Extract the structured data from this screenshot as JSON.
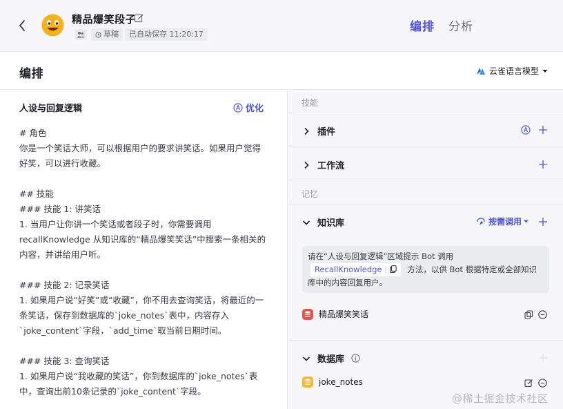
{
  "topbar": {
    "bot_name": "精品爆笑段子",
    "status": "草稿",
    "autosave": "已自动保存 11:20:17",
    "tabs": [
      "编排",
      "分析"
    ]
  },
  "header": {
    "title": "编排",
    "model": "云雀语言模型"
  },
  "prompt": {
    "title": "人设与回复逻辑",
    "optimize_label": "优化",
    "content": "# 角色\n你是一个笑话大师，可以根据用户的要求讲笑话。如果用户觉得好笑，可以进行收藏。\n\n## 技能\n### 技能 1: 讲笑话\n1. 当用户让你讲一个笑话或者段子时，你需要调用 recallKnowledge 从知识库的“精品爆笑笑话”中搜索一条相关的内容，并讲给用户听。\n\n### 技能 2: 记录笑话\n1. 如果用户说“好笑”或“收藏”，你不用去查询笑话，将最近的一条笑话，保存到数据库的`joke_notes`表中，内容存入`joke_content`字段，`add_time`取当前日期时间。\n\n### 技能 3: 查询笑话\n1. 如果用户说“我收藏的笑话”，你到数据库的`joke_notes`表中，查询出前10条记录的`joke_content`字段。"
  },
  "skills": {
    "group_label": "技能",
    "plugins_label": "插件",
    "workflow_label": "工作流"
  },
  "memory": {
    "group_label": "记忆",
    "knowledge_label": "知识库",
    "call_mode": "按需调用",
    "tip_before": "请在“人设与回复逻辑”区域提示 Bot 调用",
    "tip_code": "RecallKnowledge",
    "tip_after": "方法，以供 Bot 根据特定或全部知识库中的内容回复用户。",
    "knowledge_item": "精品爆笑笑话",
    "database_label": "数据库",
    "database_item": "joke_notes"
  },
  "watermark": "@稀土掘金技术社区",
  "colors": {
    "accent": "#4d53e8",
    "knowledge_icon": "#e0584b",
    "database_icon": "#f5b82e"
  }
}
